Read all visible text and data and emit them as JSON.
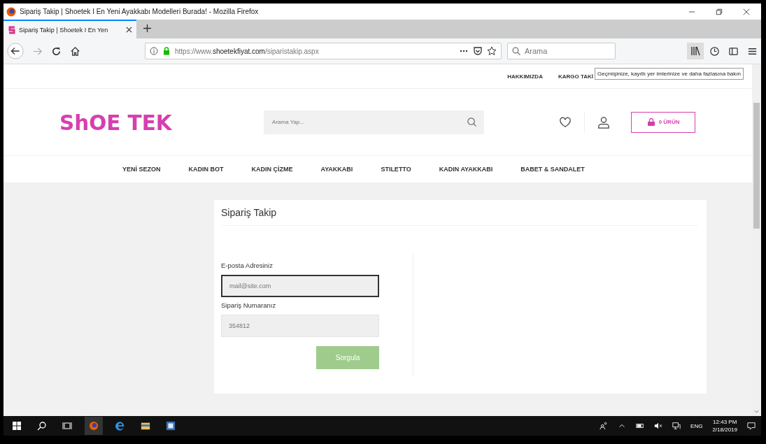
{
  "window": {
    "title": "Sipariş Takip | Shoetek I En Yeni Ayakkabı Modelleri Burada! - Mozilla Firefox"
  },
  "tabs": [
    {
      "label": "Sipariş Takip | Shoetek I En Yen",
      "selected": true
    }
  ],
  "address_bar": {
    "scheme": "https://www.",
    "domain": "shoetekfiyat.com",
    "path": "/siparistakip.aspx"
  },
  "browser_search": {
    "placeholder": "Arama"
  },
  "tooltip": "Geçmişinize, kayıtlı yer imlerinize ve daha fazlasına bakın",
  "top_links": [
    "HAKKIMIZDA",
    "KARGO TAKİ"
  ],
  "header": {
    "logo": "ShOE TEK",
    "search_placeholder": "Arama Yap...",
    "cart": "0 ÜRÜN"
  },
  "menu": [
    "YENİ SEZON",
    "KADIN BOT",
    "KADIN ÇİZME",
    "AYAKKABI",
    "STILETTO",
    "KADIN AYAKKABI",
    "BABET & SANDALET"
  ],
  "form": {
    "title": "Sipariş Takip",
    "fields": [
      {
        "label": "E-posta Adresiniz",
        "placeholder": "mail@site.com",
        "focused": true
      },
      {
        "label": "Sipariş Numaranız",
        "placeholder": "354812",
        "focused": false
      }
    ],
    "button": "Sorgula"
  },
  "taskbar": {
    "language": "ENG",
    "time": "12:43 PM",
    "date": "2/18/2019"
  }
}
